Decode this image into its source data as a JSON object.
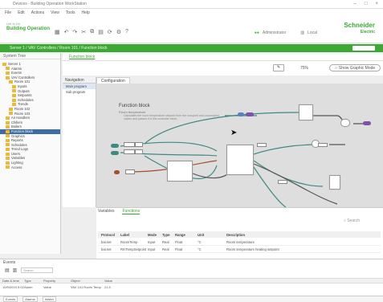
{
  "window": {
    "title": "Devices - Building Operation WorkStation",
    "controls": [
      "–",
      "□",
      "×"
    ]
  },
  "menu": [
    "File",
    "Edit",
    "Actions",
    "View",
    "Tools",
    "Help"
  ],
  "brand": {
    "line1": "Life Is On",
    "line2": "Building Operation",
    "vendor_line1": "Schneider",
    "vendor_line2": "Electric",
    "user_label": "Administrator",
    "domain_label": "Local"
  },
  "greenbar": {
    "path": "Server 1 / VAV Controllers / Room 101 / Function block"
  },
  "left_panel": {
    "header": "System Tree",
    "items": [
      {
        "label": "Server 1",
        "indent": 0,
        "selected": false
      },
      {
        "label": "Alarms",
        "indent": 1,
        "selected": false
      },
      {
        "label": "Events",
        "indent": 1,
        "selected": false
      },
      {
        "label": "VAV Controllers",
        "indent": 1,
        "selected": false
      },
      {
        "label": "Room 101",
        "indent": 2,
        "selected": false
      },
      {
        "label": "Inputs",
        "indent": 3,
        "selected": false
      },
      {
        "label": "Outputs",
        "indent": 3,
        "selected": false
      },
      {
        "label": "Setpoints",
        "indent": 3,
        "selected": false
      },
      {
        "label": "Schedules",
        "indent": 3,
        "selected": false
      },
      {
        "label": "Trends",
        "indent": 3,
        "selected": false
      },
      {
        "label": "Room 102",
        "indent": 2,
        "selected": false
      },
      {
        "label": "Room 103",
        "indent": 2,
        "selected": false
      },
      {
        "label": "Air Handlers",
        "indent": 1,
        "selected": false
      },
      {
        "label": "Chillers",
        "indent": 1,
        "selected": false
      },
      {
        "label": "Boilers",
        "indent": 1,
        "selected": false
      },
      {
        "label": "Function block",
        "indent": 1,
        "selected": true
      },
      {
        "label": "Graphics",
        "indent": 1,
        "selected": false
      },
      {
        "label": "Reports",
        "indent": 1,
        "selected": false
      },
      {
        "label": "Schedules",
        "indent": 1,
        "selected": false
      },
      {
        "label": "Trend Logs",
        "indent": 1,
        "selected": false
      },
      {
        "label": "Users",
        "indent": 1,
        "selected": false
      },
      {
        "label": "Variables",
        "indent": 1,
        "selected": false
      },
      {
        "label": "Lighting",
        "indent": 1,
        "selected": false
      },
      {
        "label": "Access",
        "indent": 1,
        "selected": false
      }
    ]
  },
  "document_tab": "Function block",
  "editor": {
    "zoom": "75%",
    "show_mode_label": "Show Graphic Mode"
  },
  "navigation": {
    "tab": "Navigation",
    "items": [
      {
        "label": "Main program",
        "selected": true
      },
      {
        "label": "Sub program",
        "selected": false
      }
    ]
  },
  "canvas": {
    "tab": "Configuration",
    "title": "Function block",
    "subtitle": "Room temperature",
    "description": "Calculates the room temperature setpoint from the occupied and unoccupied values and passes it to the controller block."
  },
  "bottom": {
    "tabs": [
      {
        "label": "Variables",
        "active": false
      },
      {
        "label": "Functions",
        "active": true
      }
    ],
    "search_placeholder": "Search",
    "columns": [
      "Protocol",
      "Label",
      "Mode",
      "Type",
      "Range",
      "Unit",
      "Description"
    ],
    "rows": [
      [
        "bacnet",
        "RoomTemp",
        "Input",
        "Real",
        "Float",
        "°C",
        "Room temperature"
      ],
      [
        "bacnet",
        "RmTempSetpoint",
        "Input",
        "Real",
        "Float",
        "°C",
        "Room temperature heating setpoint"
      ]
    ]
  },
  "status": {
    "title": "Events",
    "search_placeholder": "Search",
    "columns": [
      "Date & time",
      "Type",
      "Property",
      "Object",
      "Value"
    ],
    "row": [
      "10/9/2019 9:02",
      "Alarm",
      "Value",
      "VAV 101 Room Temp",
      "21.5"
    ],
    "tabs": [
      "Events",
      "Alarms",
      "Watch"
    ]
  },
  "colors": {
    "accent": "#3da935",
    "selection": "#3b6ea8",
    "port_purple": "#7b52a8",
    "wire": "#3e8a80"
  }
}
